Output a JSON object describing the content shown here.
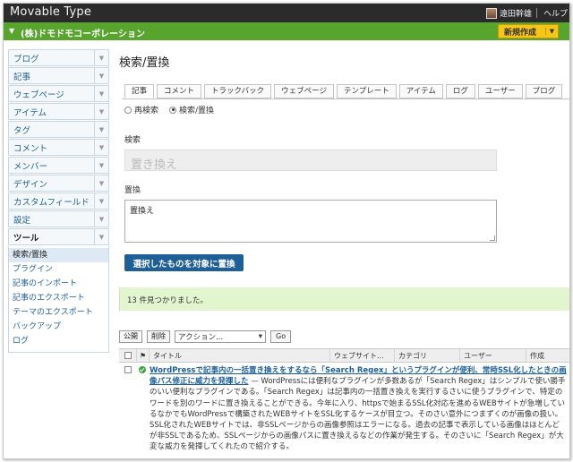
{
  "app": {
    "logo": "Movable Type",
    "user_name": "遠田幹雄",
    "help": "ヘルプ"
  },
  "site": {
    "name": "(株)ドモドモコーポレーション",
    "new_button": "新規作成"
  },
  "sidebar": {
    "items": [
      {
        "label": "ブログ"
      },
      {
        "label": "記事"
      },
      {
        "label": "ウェブページ"
      },
      {
        "label": "アイテム"
      },
      {
        "label": "タグ"
      },
      {
        "label": "コメント"
      },
      {
        "label": "メンバー"
      },
      {
        "label": "デザイン"
      },
      {
        "label": "カスタムフィールド"
      },
      {
        "label": "設定"
      }
    ],
    "tools": {
      "label": "ツール",
      "sub": [
        {
          "label": "検索/置換"
        },
        {
          "label": "プラグイン"
        },
        {
          "label": "記事のインポート"
        },
        {
          "label": "記事のエクスポート"
        },
        {
          "label": "テーマのエクスポート"
        },
        {
          "label": "バックアップ"
        },
        {
          "label": "ログ"
        }
      ]
    }
  },
  "main": {
    "title": "検索/置換",
    "tabs": [
      {
        "label": "記事"
      },
      {
        "label": "コメント"
      },
      {
        "label": "トラックバック"
      },
      {
        "label": "ウェブページ"
      },
      {
        "label": "テンプレート"
      },
      {
        "label": "アイテム"
      },
      {
        "label": "ログ"
      },
      {
        "label": "ユーザー"
      },
      {
        "label": "ブログ"
      }
    ],
    "radio_research": "再検索",
    "radio_search_replace": "検索/置換",
    "search_label": "検索",
    "search_placeholder": "置き換え",
    "replace_label": "置換",
    "replace_value": "置換え",
    "replace_button": "選択したものを対象に置換",
    "result_message": "13 件見つかりました。"
  },
  "list": {
    "publish": "公開",
    "delete": "削除",
    "action_select": "アクション...",
    "go": "Go",
    "columns": {
      "title": "タイトル",
      "website": "ウェブサイト...",
      "category": "カテゴリ",
      "user": "ユーザー",
      "created": "作成"
    },
    "rows": [
      {
        "title": "WordPressで記事内の一括置き換えをするなら「Search Regex」というプラグインが便利、常時SSL化したときの画像パス修正に威力を発揮した",
        "excerpt": " — WordPressには便利なプラグインが多数あるが「Search Regex」はシンプルで使い勝手のいい便利なプラグインである。「Search Regex」は記事内の一括置き換えを実行するさいに使うプラグインで、特定のワードを別のワードに置き換えることができる。今年に入り、httpsで始まるSSL化対応を進めるWEBサイトが急増しているなかでもWordPressで構築されたWEBサイトをSSL化するケースが目立つ。そのさい意外につまずくのが画像の扱い。SSL化されたWEBサイトでは、非SSLページからの画像参照はエラーになる。過去の記事で表示している画像はほとんどが非SSLであるため、SSLページからの画像パスに置き換えるなどの作業が発生する。そのさいに「Search Regex」が大変な威力を発揮してくれたので紹介する。"
      }
    ]
  }
}
